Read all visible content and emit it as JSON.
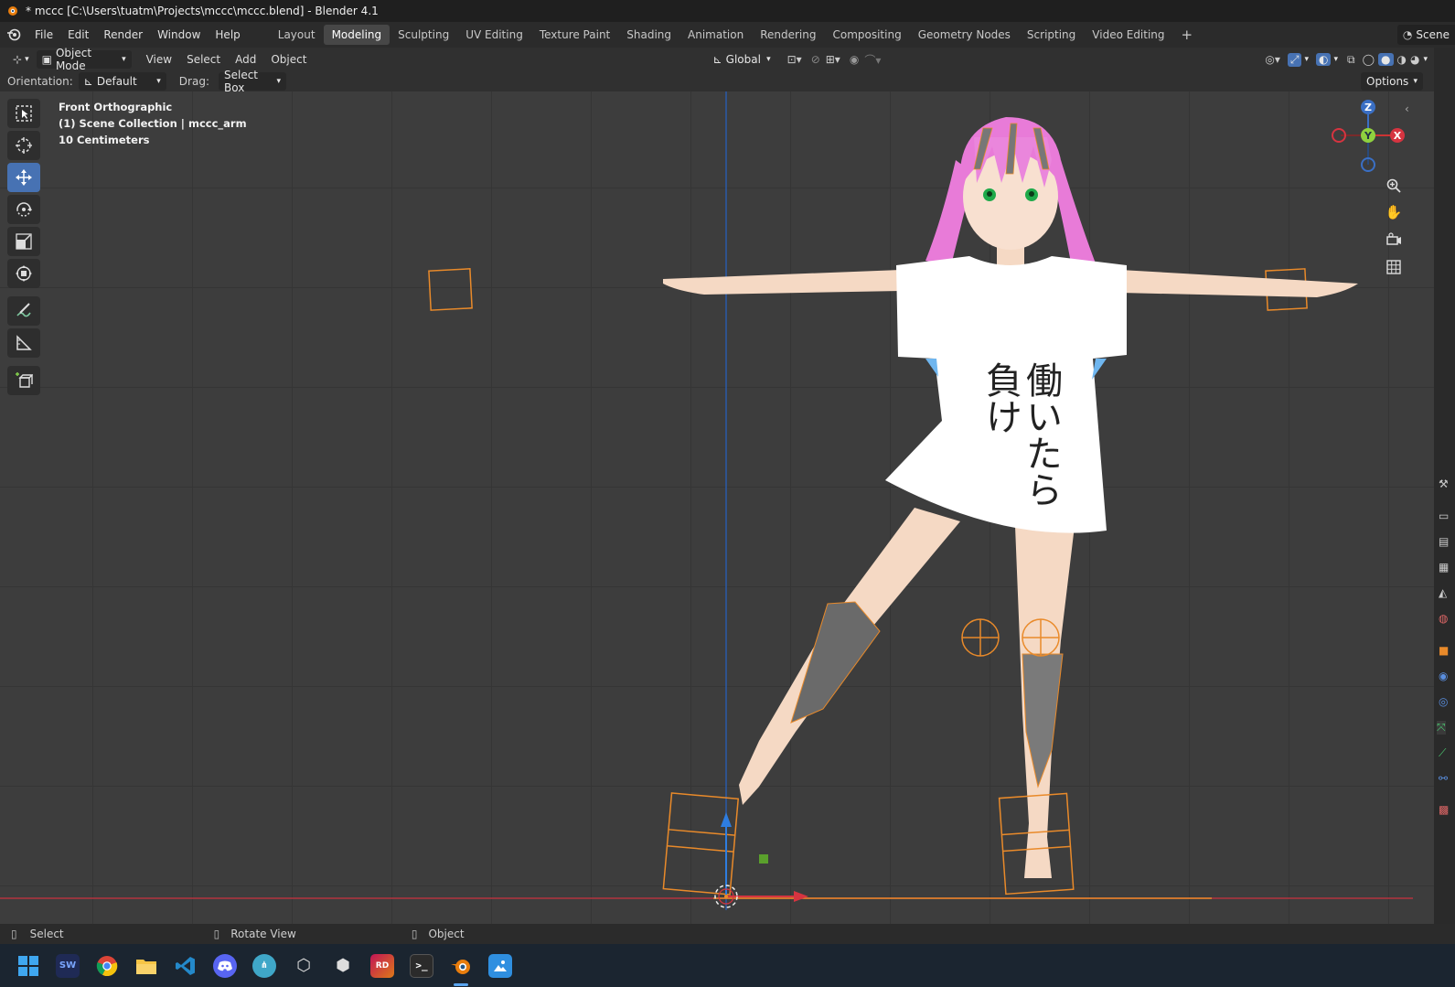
{
  "window": {
    "title": "* mccc [C:\\Users\\tuatm\\Projects\\mccc\\mccc.blend] - Blender 4.1"
  },
  "menu": [
    "File",
    "Edit",
    "Render",
    "Window",
    "Help"
  ],
  "workspaces": [
    "Layout",
    "Modeling",
    "Sculpting",
    "UV Editing",
    "Texture Paint",
    "Shading",
    "Animation",
    "Rendering",
    "Compositing",
    "Geometry Nodes",
    "Scripting",
    "Video Editing"
  ],
  "active_workspace": "Modeling",
  "scene_label": "Scene",
  "header": {
    "mode": "Object Mode",
    "view": "View",
    "select": "Select",
    "add": "Add",
    "object": "Object",
    "transform": "Global",
    "options": "Options"
  },
  "tool_settings": {
    "orientation_label": "Orientation:",
    "orientation_value": "Default",
    "drag_label": "Drag:",
    "drag_value": "Select Box"
  },
  "viewport_info": {
    "view_name": "Front Orthographic",
    "collection": "(1) Scene Collection | mccc_arm",
    "scale": "10 Centimeters"
  },
  "gizmo": {
    "z": "Z",
    "y": "Y",
    "x": "X"
  },
  "shirt_text": {
    "line1": "働いたら",
    "line2": "負け"
  },
  "status": {
    "select": "Select",
    "rotate": "Rotate View",
    "object": "Object"
  },
  "taskbar": [
    "windows-start",
    "sw",
    "chrome",
    "files",
    "vscode",
    "discord",
    "app-blue",
    "unity",
    "unity-hub",
    "rider",
    "terminal",
    "blender",
    "photos"
  ],
  "colors": {
    "accent": "#4772b3",
    "selection": "#f39c12",
    "hair": "#e87bd8"
  }
}
